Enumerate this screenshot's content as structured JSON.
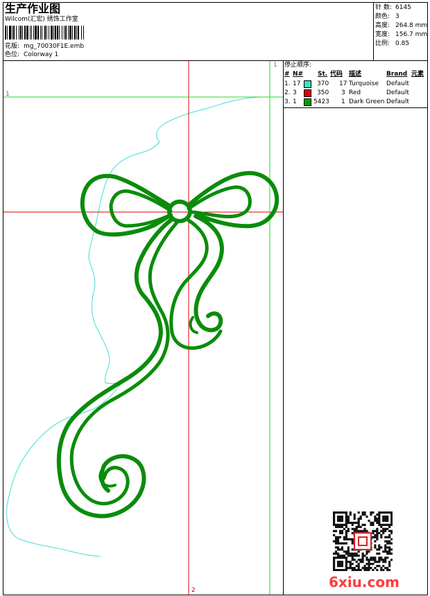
{
  "header": {
    "title": "生产作业图",
    "studio": "Wilcom(汇宏) 绣饰工作室",
    "design_label": "花版:",
    "design_value": "mg_70030F1E.emb",
    "colorway_label": "色位:",
    "colorway_value": "Colorway 1"
  },
  "stats": [
    {
      "label": "针 数:",
      "value": "6145"
    },
    {
      "label": "颜色:",
      "value": "3"
    },
    {
      "label": "高度:",
      "value": "264.8 mm"
    },
    {
      "label": "宽度:",
      "value": "156.7 mm"
    },
    {
      "label": "比例:",
      "value": "0.85"
    }
  ],
  "stop_sequence": {
    "title": "停止顺序:",
    "headers": [
      "#",
      "N#",
      "St.",
      "代码",
      "描述",
      "Brand",
      "元素"
    ],
    "rows": [
      {
        "idx": "1.",
        "n": "17",
        "color": "#40e0c0",
        "st": "370",
        "code": "17",
        "desc": "Turquoise",
        "brand": "Default"
      },
      {
        "idx": "2.",
        "n": "3",
        "color": "#e00000",
        "st": "350",
        "code": "3",
        "desc": "Red",
        "brand": "Default"
      },
      {
        "idx": "3.",
        "n": "1",
        "color": "#00a000",
        "st": "5423",
        "code": "1",
        "desc": "Dark Green",
        "brand": "Default"
      }
    ]
  },
  "guides": {
    "h1_label": "1",
    "v1_label": "1",
    "v2_label": "2"
  },
  "watermark": "6xiu.com",
  "colors": {
    "stitch_green": "#0a8c0a",
    "guide_green": "#22dd22",
    "guide_red": "#dd0000",
    "outline_cyan": "#40e0d0"
  }
}
